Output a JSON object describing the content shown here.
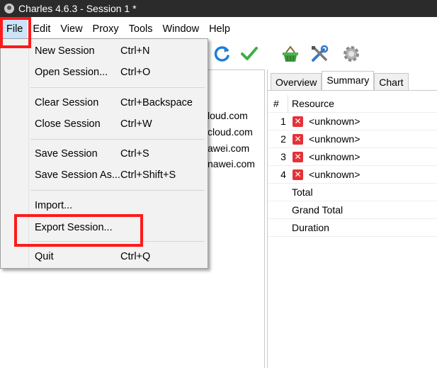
{
  "window": {
    "title": "Charles 4.6.3 - Session 1 *"
  },
  "menubar": [
    "File",
    "Edit",
    "View",
    "Proxy",
    "Tools",
    "Window",
    "Help"
  ],
  "file_menu": {
    "items": [
      {
        "label": "New Session",
        "shortcut": "Ctrl+N"
      },
      {
        "label": "Open Session...",
        "shortcut": "Ctrl+O"
      },
      {
        "label": "Clear Session",
        "shortcut": "Ctrl+Backspace"
      },
      {
        "label": "Close Session",
        "shortcut": "Ctrl+W"
      },
      {
        "label": "Save Session",
        "shortcut": "Ctrl+S"
      },
      {
        "label": "Save Session As...",
        "shortcut": "Ctrl+Shift+S"
      },
      {
        "label": "Import...",
        "shortcut": ""
      },
      {
        "label": "Export Session...",
        "shortcut": ""
      },
      {
        "label": "Quit",
        "shortcut": "Ctrl+Q"
      }
    ]
  },
  "toolbar": {
    "icons": [
      "refresh-icon",
      "validate-check-icon",
      "shopping-basket-icon",
      "tools-icon",
      "settings-gear-icon"
    ],
    "colors": {
      "refresh": "#1e7fd6",
      "check": "#3cb043",
      "basket": "#3a9b3a",
      "gear": "#9a9a9a"
    }
  },
  "left_pane": {
    "hosts": [
      "loud.com",
      "cloud.com",
      "awei.com",
      "nawei.com"
    ]
  },
  "right_pane": {
    "tabs": [
      "Overview",
      "Summary",
      "Chart"
    ],
    "active_tab": "Summary",
    "headers": {
      "number": "#",
      "resource": "Resource"
    },
    "rows": [
      {
        "num": "1",
        "resource": "<unknown>"
      },
      {
        "num": "2",
        "resource": "<unknown>"
      },
      {
        "num": "3",
        "resource": "<unknown>"
      },
      {
        "num": "4",
        "resource": "<unknown>"
      }
    ],
    "totals": [
      "Total",
      "Grand Total",
      "Duration"
    ]
  },
  "annotation_color": "#ff1a1a"
}
